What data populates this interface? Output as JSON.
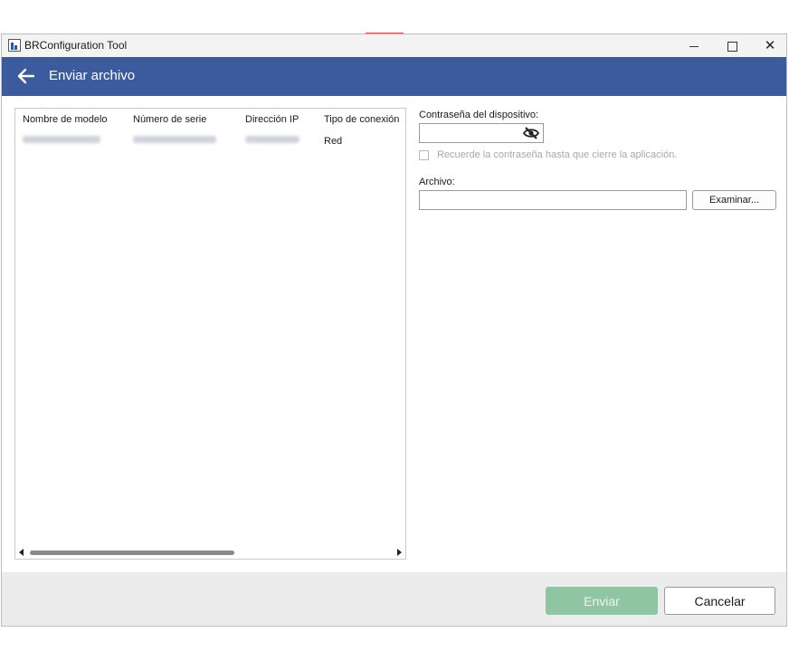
{
  "window": {
    "title": "BRConfiguration Tool",
    "controls": {
      "minimize": "minimize-icon",
      "maximize": "maximize-icon",
      "close": "close-icon"
    }
  },
  "header": {
    "title": "Enviar archivo",
    "back_icon": "arrow-left-icon",
    "color": "#3c5b9e"
  },
  "device_list": {
    "columns": [
      "Nombre de modelo",
      "Número de serie",
      "Dirección IP",
      "Tipo de conexión"
    ],
    "rows": [
      {
        "model": "",
        "serial": "",
        "ip": "",
        "connection": "Red"
      }
    ]
  },
  "form": {
    "password_label": "Contraseña del dispositivo:",
    "password_value": "",
    "eye_icon": "eye-slash-icon",
    "remember_label": "Recuerde la contraseña hasta que cierre la aplicación.",
    "remember_checked": false,
    "file_label": "Archivo:",
    "file_value": "",
    "browse_label": "Examinar..."
  },
  "footer": {
    "send_label": "Enviar",
    "send_color": "#8fc5a3",
    "cancel_label": "Cancelar"
  }
}
